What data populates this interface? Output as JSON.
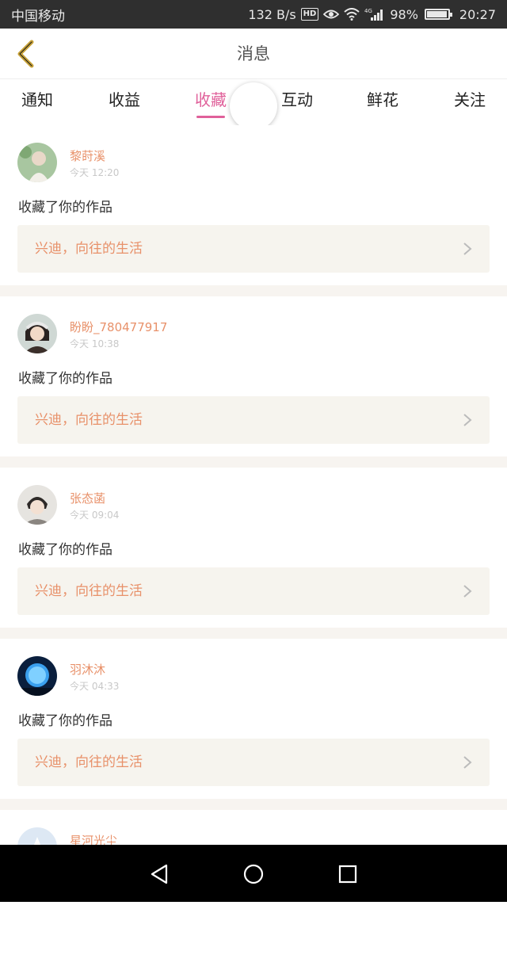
{
  "status_bar": {
    "carrier": "中国移动",
    "speed": "132 B/s",
    "hd": "HD",
    "network": "4G",
    "battery": "98%",
    "battery_level": 0.98,
    "time": "20:27"
  },
  "header": {
    "title": "消息",
    "back_icon": "chevron-left-icon"
  },
  "tabs": [
    {
      "label": "通知",
      "active": false
    },
    {
      "label": "收益",
      "active": false
    },
    {
      "label": "收藏",
      "active": true
    },
    {
      "label": "互动",
      "active": false
    },
    {
      "label": "鲜花",
      "active": false
    },
    {
      "label": "关注",
      "active": false
    }
  ],
  "colors": {
    "accent": "#e0609a",
    "name_color": "#e8916a",
    "box_bg": "#f6f4ee"
  },
  "messages": [
    {
      "name": "黎莳溪",
      "time": "今天 12:20",
      "action": "收藏了你的作品",
      "work": "兴迪，向往的生活"
    },
    {
      "name": "盼盼_780477917",
      "time": "今天 10:38",
      "action": "收藏了你的作品",
      "work": "兴迪，向往的生活"
    },
    {
      "name": "张态菡",
      "time": "今天 09:04",
      "action": "收藏了你的作品",
      "work": "兴迪，向往的生活"
    },
    {
      "name": "羽沐沐",
      "time": "今天 04:33",
      "action": "收藏了你的作品",
      "work": "兴迪，向往的生活"
    },
    {
      "name": "星河光尘",
      "time": "",
      "action": "",
      "work": ""
    }
  ],
  "nav_bar": {
    "back": "triangle-back-icon",
    "home": "circle-home-icon",
    "recents": "square-recents-icon"
  }
}
